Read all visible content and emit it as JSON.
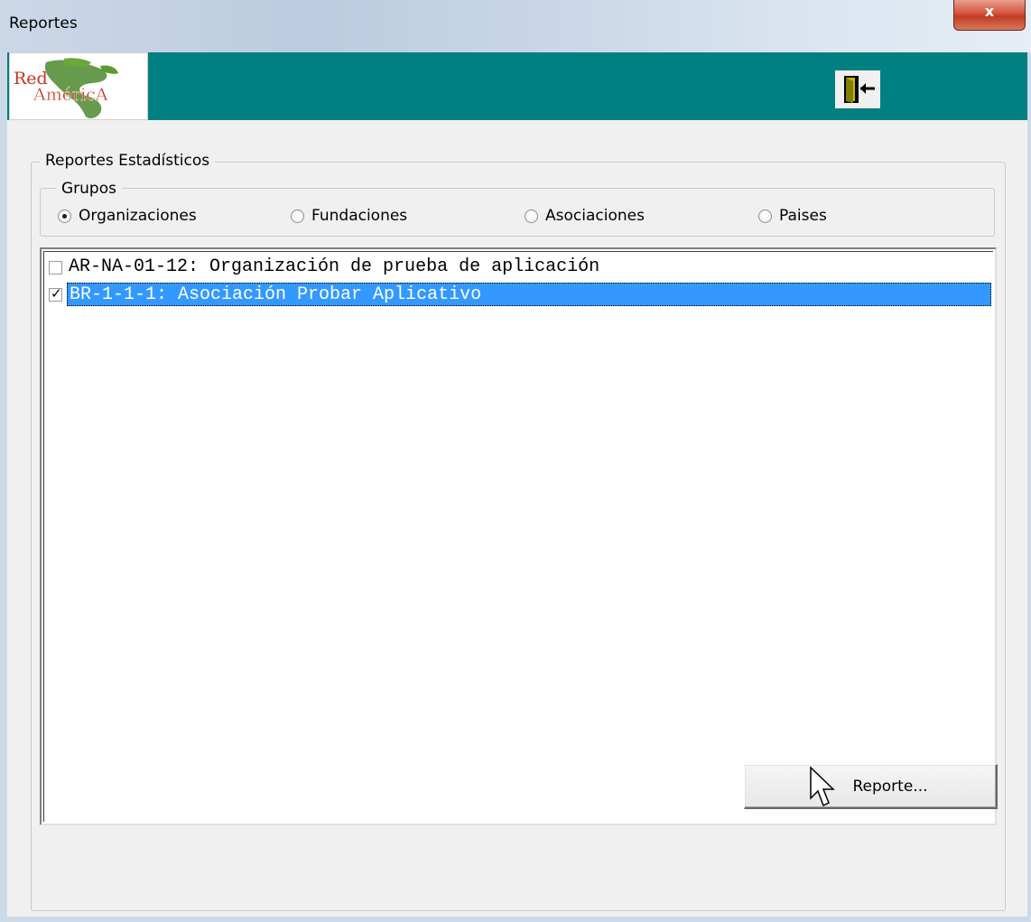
{
  "window": {
    "title": "Reportes",
    "close_label": "x"
  },
  "header": {
    "logo_text_top": "Red",
    "logo_text_bottom": "AméricA",
    "exit_icon": "exit-door-icon",
    "band_color": "#008080"
  },
  "group_reportes": {
    "label": "Reportes Estadísticos"
  },
  "group_grupos": {
    "label": "Grupos",
    "options": [
      {
        "label": "Organizaciones",
        "checked": true
      },
      {
        "label": "Fundaciones",
        "checked": false
      },
      {
        "label": "Asociaciones",
        "checked": false
      },
      {
        "label": "Paises",
        "checked": false
      }
    ]
  },
  "list": {
    "items": [
      {
        "text": "AR-NA-01-12: Organización de prueba de aplicación",
        "checked": false,
        "selected": false
      },
      {
        "text": "BR-1-1-1: Asociación Probar Aplicativo",
        "checked": true,
        "selected": true
      }
    ],
    "selection_color": "#3399ff"
  },
  "actions": {
    "report_label": "Reporte..."
  }
}
